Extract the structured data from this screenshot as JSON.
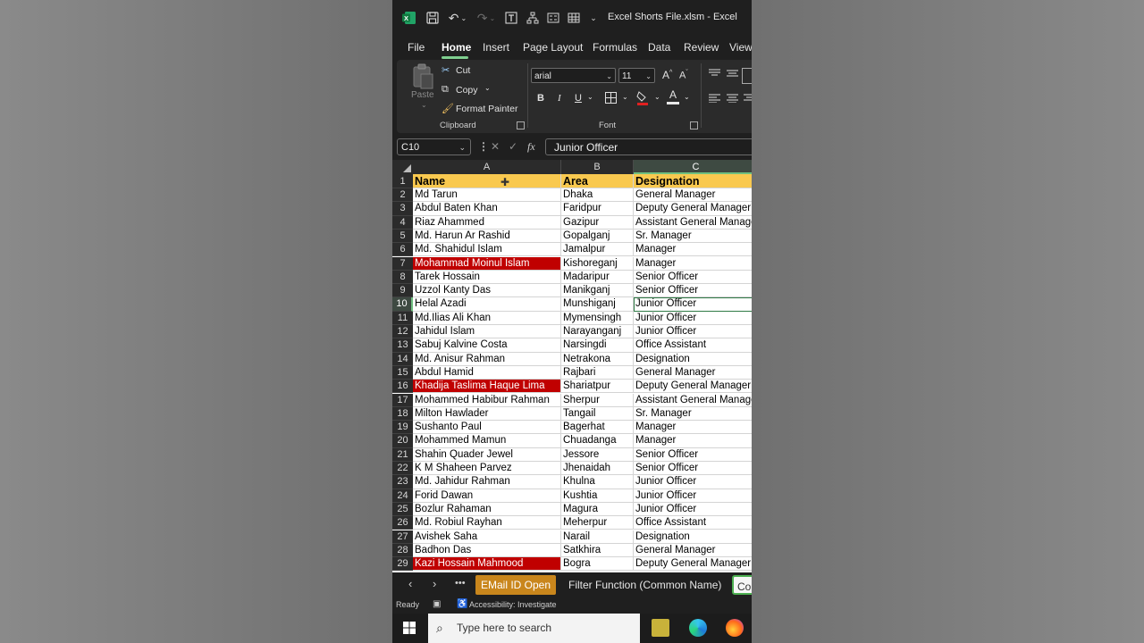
{
  "window": {
    "title": "Excel Shorts File.xlsm  -  Excel"
  },
  "menu": [
    "File",
    "Home",
    "Insert",
    "Page Layout",
    "Formulas",
    "Data",
    "Review",
    "View"
  ],
  "ribbon": {
    "paste": "Paste",
    "cut": "Cut",
    "copy": "Copy",
    "format_painter": "Format Painter",
    "clipboard": "Clipboard",
    "font_name": "arial",
    "font_size": "11",
    "bold": "B",
    "italic": "I",
    "underline": "U",
    "font_label": "Font",
    "grow": "A",
    "shrink": "A",
    "font_color": "A"
  },
  "formula_bar": {
    "name_box": "C10",
    "content": "Junior Officer"
  },
  "columns": [
    "A",
    "B",
    "C"
  ],
  "headers": {
    "name": "Name",
    "area": "Area",
    "designation": "Designation"
  },
  "rows": [
    {
      "n": "2",
      "name": "Md Tarun",
      "area": "Dhaka",
      "designation": "General Manager"
    },
    {
      "n": "3",
      "name": "Abdul Baten Khan",
      "area": "Faridpur",
      "designation": "Deputy General Manager"
    },
    {
      "n": "4",
      "name": "Riaz Ahammed",
      "area": "Gazipur",
      "designation": "Assistant General Manager"
    },
    {
      "n": "5",
      "name": "Md. Harun Ar Rashid",
      "area": "Gopalganj",
      "designation": "Sr. Manager"
    },
    {
      "n": "6",
      "name": "Md. Shahidul Islam",
      "area": "Jamalpur",
      "designation": "Manager"
    },
    {
      "n": "7",
      "name": "Mohammad Moinul Islam",
      "area": "Kishoreganj",
      "designation": "Manager",
      "highlight": true
    },
    {
      "n": "8",
      "name": "Tarek Hossain",
      "area": "Madaripur",
      "designation": "Senior Officer"
    },
    {
      "n": "9",
      "name": "Uzzol Kanty Das",
      "area": "Manikganj",
      "designation": "Senior Officer"
    },
    {
      "n": "10",
      "name": "Helal Azadi",
      "area": "Munshiganj",
      "designation": "Junior Officer"
    },
    {
      "n": "11",
      "name": "Md.Ilias Ali Khan",
      "area": "Mymensingh",
      "designation": "Junior Officer"
    },
    {
      "n": "12",
      "name": "Jahidul Islam",
      "area": "Narayanganj",
      "designation": "Junior Officer"
    },
    {
      "n": "13",
      "name": "Sabuj Kalvine Costa",
      "area": "Narsingdi",
      "designation": "Office Assistant"
    },
    {
      "n": "14",
      "name": "Md. Anisur Rahman",
      "area": "Netrakona",
      "designation": "Designation"
    },
    {
      "n": "15",
      "name": "Abdul Hamid",
      "area": "Rajbari",
      "designation": "General Manager"
    },
    {
      "n": "16",
      "name": "Khadija Taslima Haque Lima",
      "area": "Shariatpur",
      "designation": "Deputy General Manager",
      "highlight": true
    },
    {
      "n": "17",
      "name": "Mohammed Habibur Rahman",
      "area": "Sherpur",
      "designation": "Assistant General Manager"
    },
    {
      "n": "18",
      "name": "Milton Hawlader",
      "area": "Tangail",
      "designation": "Sr. Manager"
    },
    {
      "n": "19",
      "name": "Sushanto Paul",
      "area": "Bagerhat",
      "designation": "Manager"
    },
    {
      "n": "20",
      "name": "Mohammed Mamun",
      "area": "Chuadanga",
      "designation": "Manager"
    },
    {
      "n": "21",
      "name": "Shahin Quader Jewel",
      "area": "Jessore",
      "designation": "Senior Officer"
    },
    {
      "n": "22",
      "name": "K M Shaheen Parvez",
      "area": "Jhenaidah",
      "designation": "Senior Officer"
    },
    {
      "n": "23",
      "name": "Md. Jahidur Rahman",
      "area": "Khulna",
      "designation": "Junior Officer"
    },
    {
      "n": "24",
      "name": "Forid Dawan",
      "area": "Kushtia",
      "designation": "Junior Officer"
    },
    {
      "n": "25",
      "name": "Bozlur Rahaman",
      "area": "Magura",
      "designation": "Junior Officer"
    },
    {
      "n": "26",
      "name": "Md. Robiul Rayhan",
      "area": "Meherpur",
      "designation": "Office Assistant"
    },
    {
      "n": "27",
      "name": "Avishek Saha",
      "area": "Narail",
      "designation": "Designation"
    },
    {
      "n": "28",
      "name": "Badhon Das",
      "area": "Satkhira",
      "designation": "General Manager"
    },
    {
      "n": "29",
      "name": "Kazi Hossain Mahmood",
      "area": "Bogra",
      "designation": "Deputy General Manager",
      "highlight": true
    }
  ],
  "sheet_tabs": [
    "EMail ID Open",
    "Filter Function (Common Name)",
    "Co"
  ],
  "status": {
    "ready": "Ready",
    "accessibility": "Accessibility: Investigate"
  },
  "taskbar": {
    "search_placeholder": "Type here to search"
  },
  "colors": {
    "header_fill": "#f9c94f",
    "highlight_fill": "#c00000",
    "tab_orange": "#c9861c",
    "accent_green": "#6fbf80"
  }
}
